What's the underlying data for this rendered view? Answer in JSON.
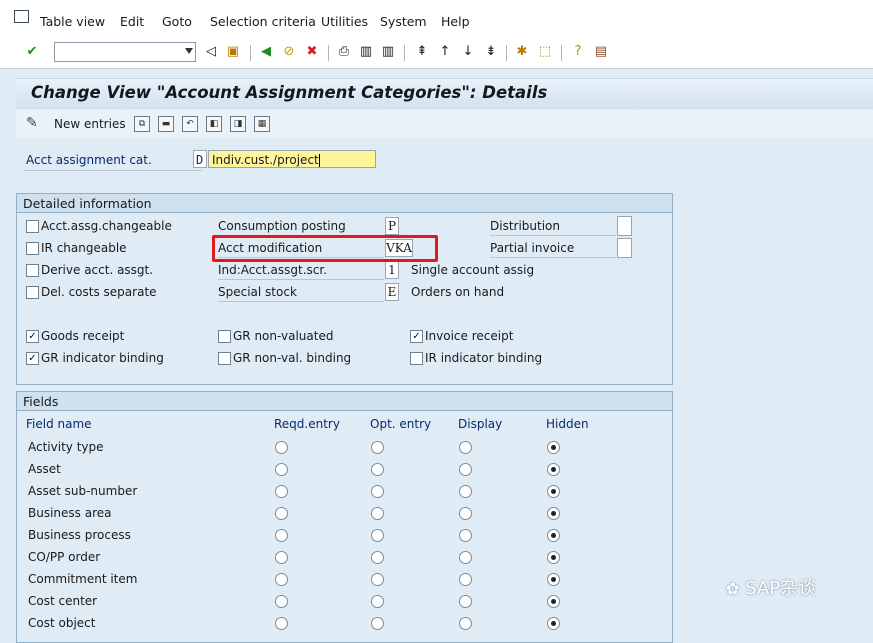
{
  "menu": {
    "items": [
      "Table view",
      "Edit",
      "Goto",
      "Selection criteria",
      "Utilities",
      "System",
      "Help"
    ]
  },
  "toolbar": {
    "command_field_value": "",
    "icons": [
      "enter-icon",
      "back-nav-icon",
      "save-icon",
      "back-icon",
      "exit-icon",
      "cancel-icon",
      "print-icon",
      "find-icon",
      "find-next-icon",
      "first-page-icon",
      "previous-page-icon",
      "next-page-icon",
      "last-page-icon",
      "create-session-icon",
      "shortcut-icon",
      "help-icon",
      "customize-layout-icon"
    ]
  },
  "title": "Change View \"Account Assignment Categories\": Details",
  "app_toolbar": {
    "new_entries_label": "New entries"
  },
  "key": {
    "label": "Acct assignment cat.",
    "code": "D",
    "description": "Indiv.cust./project"
  },
  "detailed_info": {
    "title": "Detailed information",
    "checkboxes_left": [
      {
        "label": "Acct.assg.changeable",
        "checked": false
      },
      {
        "label": "IR changeable",
        "checked": false
      },
      {
        "label": "Derive acct. assgt.",
        "checked": false
      },
      {
        "label": "Del. costs separate",
        "checked": false
      }
    ],
    "fields_mid": [
      {
        "label": "Consumption posting",
        "value": "P",
        "text": ""
      },
      {
        "label": "Acct modification",
        "value": "VKA",
        "text": ""
      },
      {
        "label": "Ind:Acct.assgt.scr.",
        "value": "1",
        "text": "Single account assig"
      },
      {
        "label": "Special stock",
        "value": "E",
        "text": "Orders on hand"
      }
    ],
    "fields_right": [
      {
        "label": "Distribution",
        "value": ""
      },
      {
        "label": "Partial invoice",
        "value": ""
      }
    ],
    "checks_row1": [
      {
        "label": "Goods receipt",
        "checked": true
      },
      {
        "label": "GR non-valuated",
        "checked": false
      },
      {
        "label": "Invoice receipt",
        "checked": true
      }
    ],
    "checks_row2": [
      {
        "label": "GR indicator binding",
        "checked": true
      },
      {
        "label": "GR non-val. binding",
        "checked": false
      },
      {
        "label": "IR indicator binding",
        "checked": false
      }
    ]
  },
  "fields": {
    "title": "Fields",
    "columns": [
      "Field name",
      "Reqd.entry",
      "Opt. entry",
      "Display",
      "Hidden"
    ],
    "rows": [
      {
        "name": "Activity type",
        "selected": "Hidden"
      },
      {
        "name": "Asset",
        "selected": "Hidden"
      },
      {
        "name": "Asset sub-number",
        "selected": "Hidden"
      },
      {
        "name": "Business area",
        "selected": "Hidden"
      },
      {
        "name": "Business process",
        "selected": "Hidden"
      },
      {
        "name": "CO/PP order",
        "selected": "Hidden"
      },
      {
        "name": "Commitment item",
        "selected": "Hidden"
      },
      {
        "name": "Cost center",
        "selected": "Hidden"
      },
      {
        "name": "Cost object",
        "selected": "Hidden"
      }
    ]
  },
  "watermark": "SAP杂谈",
  "colors": {
    "highlight": "#e01a1a",
    "key_field_bg": "#fff59a",
    "label_blue": "#0a2a6e"
  }
}
